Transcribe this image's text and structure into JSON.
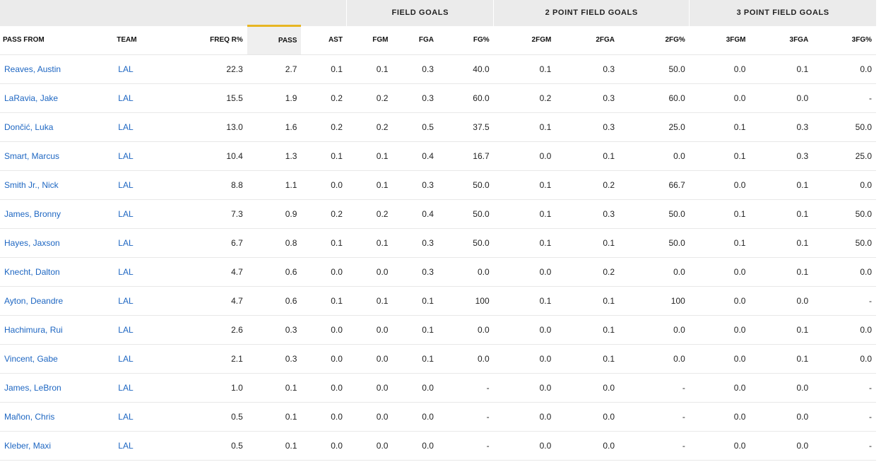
{
  "groups": {
    "field_goals": "FIELD GOALS",
    "two_point": "2 POINT FIELD GOALS",
    "three_point": "3 POINT FIELD GOALS"
  },
  "columns": [
    "PASS FROM",
    "TEAM",
    "FREQ R%",
    "PASS",
    "AST",
    "FGM",
    "FGA",
    "FG%",
    "2FGM",
    "2FGA",
    "2FG%",
    "3FGM",
    "3FGA",
    "3FG%"
  ],
  "sorted_column": "PASS",
  "rows": [
    {
      "player": "Reaves, Austin",
      "team": "LAL",
      "values": [
        "22.3",
        "2.7",
        "0.1",
        "0.1",
        "0.3",
        "40.0",
        "0.1",
        "0.3",
        "50.0",
        "0.0",
        "0.1",
        "0.0"
      ]
    },
    {
      "player": "LaRavia, Jake",
      "team": "LAL",
      "values": [
        "15.5",
        "1.9",
        "0.2",
        "0.2",
        "0.3",
        "60.0",
        "0.2",
        "0.3",
        "60.0",
        "0.0",
        "0.0",
        "-"
      ]
    },
    {
      "player": "Dončić, Luka",
      "team": "LAL",
      "values": [
        "13.0",
        "1.6",
        "0.2",
        "0.2",
        "0.5",
        "37.5",
        "0.1",
        "0.3",
        "25.0",
        "0.1",
        "0.3",
        "50.0"
      ]
    },
    {
      "player": "Smart, Marcus",
      "team": "LAL",
      "values": [
        "10.4",
        "1.3",
        "0.1",
        "0.1",
        "0.4",
        "16.7",
        "0.0",
        "0.1",
        "0.0",
        "0.1",
        "0.3",
        "25.0"
      ]
    },
    {
      "player": "Smith Jr., Nick",
      "team": "LAL",
      "values": [
        "8.8",
        "1.1",
        "0.0",
        "0.1",
        "0.3",
        "50.0",
        "0.1",
        "0.2",
        "66.7",
        "0.0",
        "0.1",
        "0.0"
      ]
    },
    {
      "player": "James, Bronny",
      "team": "LAL",
      "values": [
        "7.3",
        "0.9",
        "0.2",
        "0.2",
        "0.4",
        "50.0",
        "0.1",
        "0.3",
        "50.0",
        "0.1",
        "0.1",
        "50.0"
      ]
    },
    {
      "player": "Hayes, Jaxson",
      "team": "LAL",
      "values": [
        "6.7",
        "0.8",
        "0.1",
        "0.1",
        "0.3",
        "50.0",
        "0.1",
        "0.1",
        "50.0",
        "0.1",
        "0.1",
        "50.0"
      ]
    },
    {
      "player": "Knecht, Dalton",
      "team": "LAL",
      "values": [
        "4.7",
        "0.6",
        "0.0",
        "0.0",
        "0.3",
        "0.0",
        "0.0",
        "0.2",
        "0.0",
        "0.0",
        "0.1",
        "0.0"
      ]
    },
    {
      "player": "Ayton, Deandre",
      "team": "LAL",
      "values": [
        "4.7",
        "0.6",
        "0.1",
        "0.1",
        "0.1",
        "100",
        "0.1",
        "0.1",
        "100",
        "0.0",
        "0.0",
        "-"
      ]
    },
    {
      "player": "Hachimura, Rui",
      "team": "LAL",
      "values": [
        "2.6",
        "0.3",
        "0.0",
        "0.0",
        "0.1",
        "0.0",
        "0.0",
        "0.1",
        "0.0",
        "0.0",
        "0.1",
        "0.0"
      ]
    },
    {
      "player": "Vincent, Gabe",
      "team": "LAL",
      "values": [
        "2.1",
        "0.3",
        "0.0",
        "0.0",
        "0.1",
        "0.0",
        "0.0",
        "0.1",
        "0.0",
        "0.0",
        "0.1",
        "0.0"
      ]
    },
    {
      "player": "James, LeBron",
      "team": "LAL",
      "values": [
        "1.0",
        "0.1",
        "0.0",
        "0.0",
        "0.0",
        "-",
        "0.0",
        "0.0",
        "-",
        "0.0",
        "0.0",
        "-"
      ]
    },
    {
      "player": "Mañon, Chris",
      "team": "LAL",
      "values": [
        "0.5",
        "0.1",
        "0.0",
        "0.0",
        "0.0",
        "-",
        "0.0",
        "0.0",
        "-",
        "0.0",
        "0.0",
        "-"
      ]
    },
    {
      "player": "Kleber, Maxi",
      "team": "LAL",
      "values": [
        "0.5",
        "0.1",
        "0.0",
        "0.0",
        "0.0",
        "-",
        "0.0",
        "0.0",
        "-",
        "0.0",
        "0.0",
        "-"
      ]
    }
  ]
}
